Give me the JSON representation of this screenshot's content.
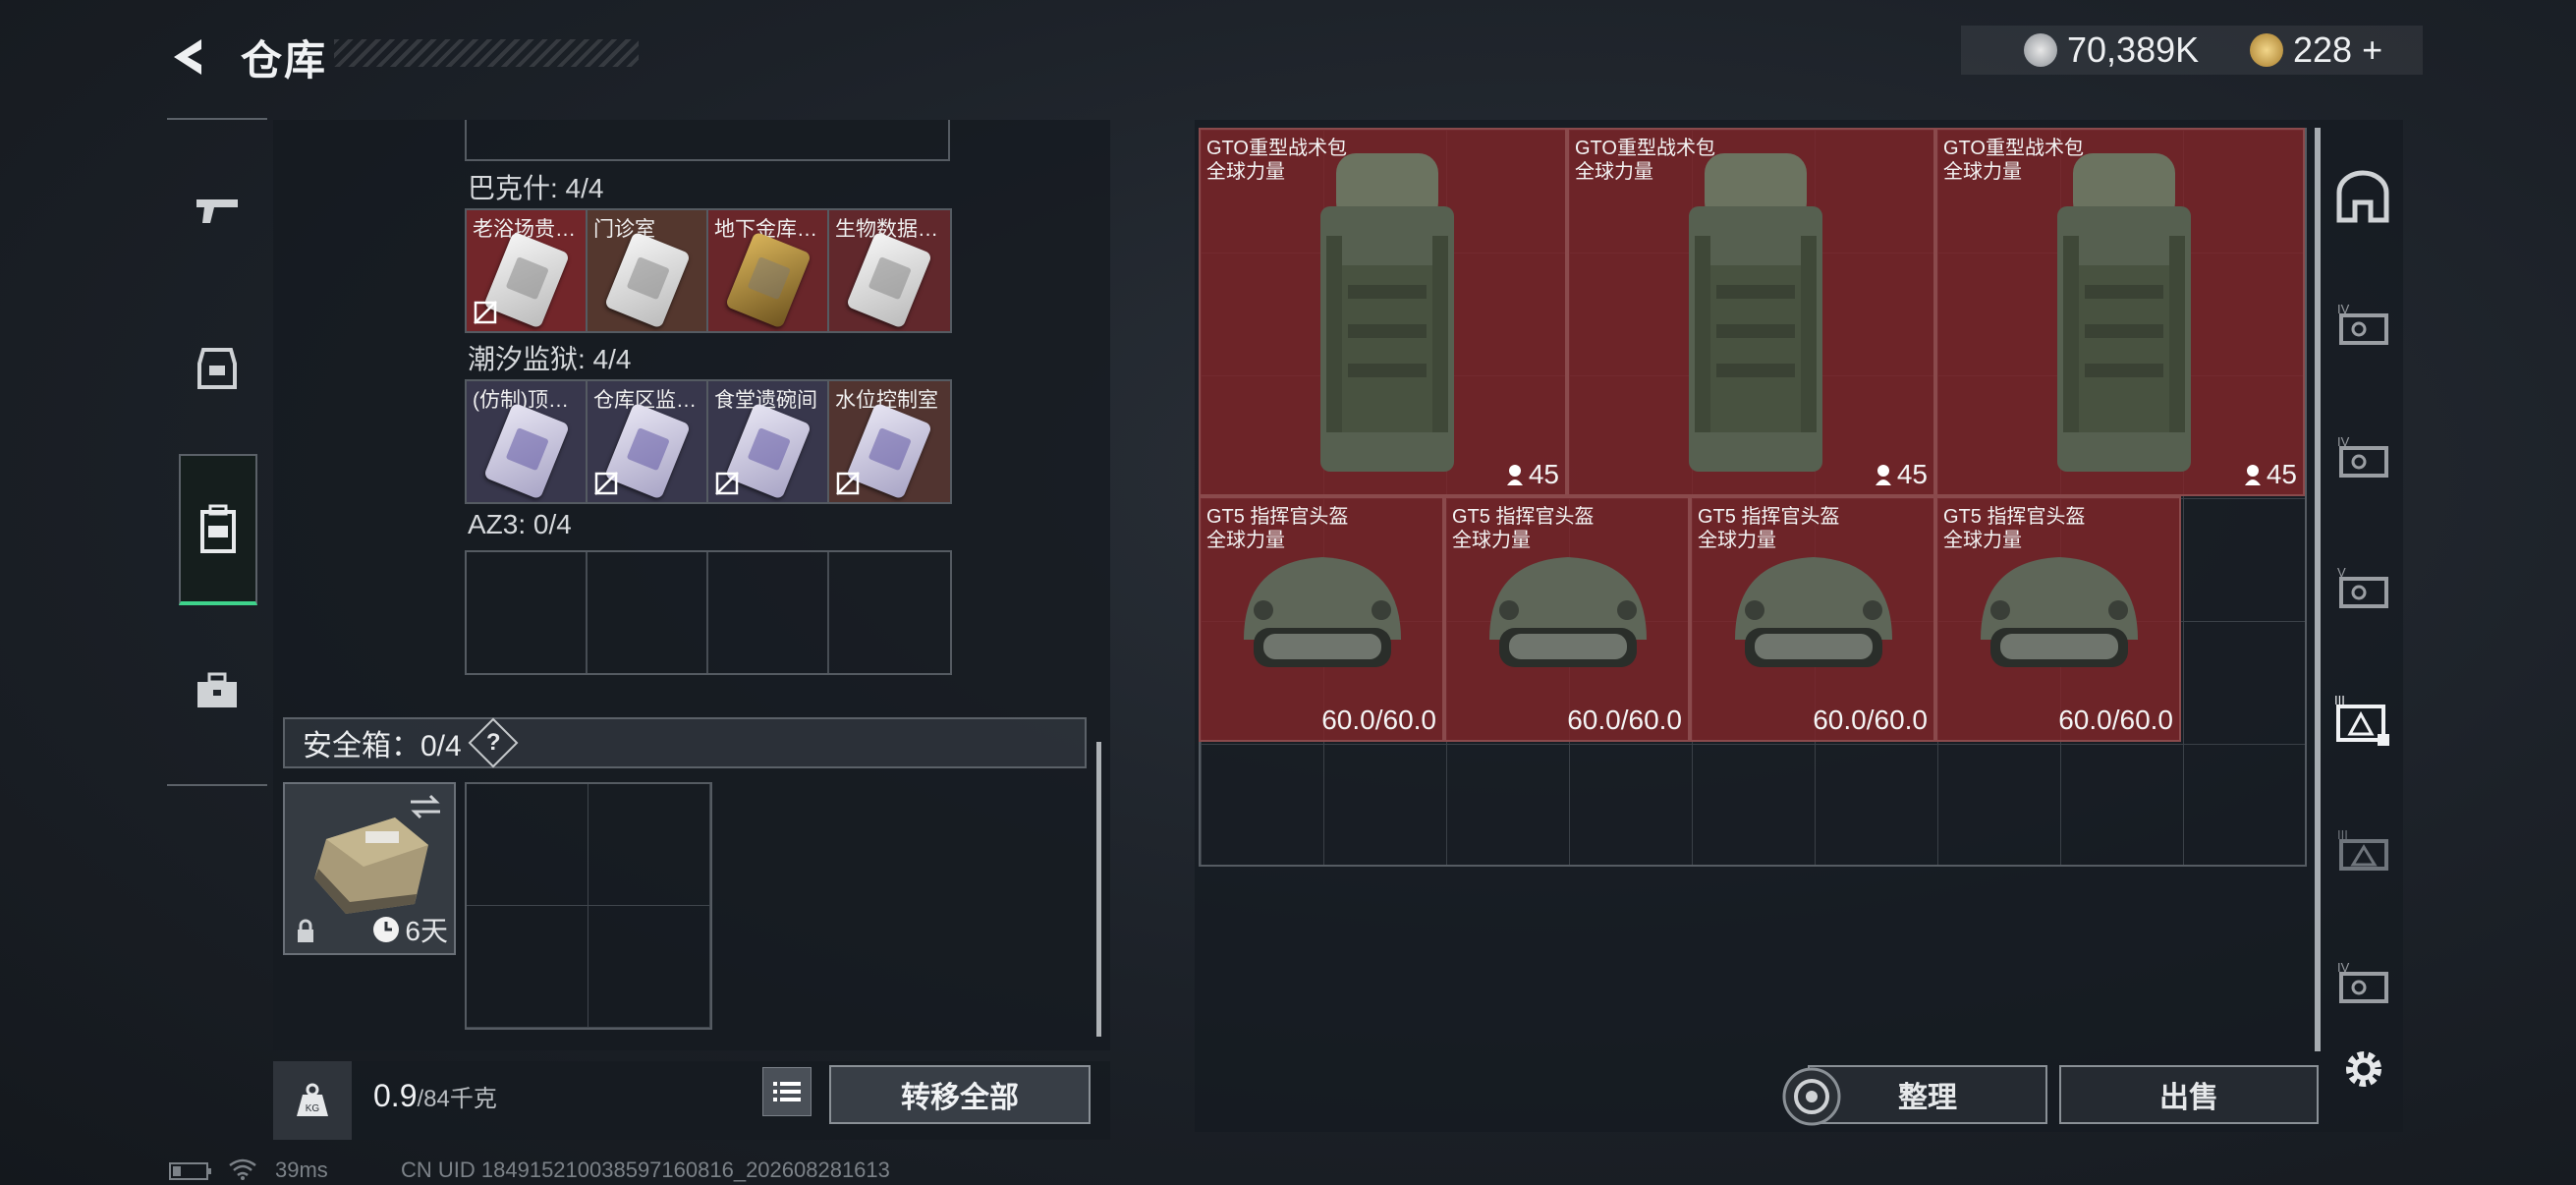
{
  "header": {
    "title": "仓库"
  },
  "currency": {
    "silver": "70,389K",
    "gold": "228",
    "add": "+"
  },
  "nav": [
    "gun-icon",
    "armor-icon",
    "backpack-icon",
    "toolbox-icon"
  ],
  "keys": {
    "sections": [
      {
        "title": "巴克什: 4/4",
        "cards": [
          {
            "label": "老浴场贵…",
            "style": "white",
            "notrade": true
          },
          {
            "label": "门诊室",
            "style": "white",
            "notrade": false
          },
          {
            "label": "地下金库…",
            "style": "gold",
            "notrade": false
          },
          {
            "label": "生物数据…",
            "style": "white",
            "notrade": false
          }
        ]
      },
      {
        "title": "潮汐监狱: 4/4",
        "cards": [
          {
            "label": "(仿制)顶…",
            "style": "purple",
            "notrade": false
          },
          {
            "label": "仓库区监…",
            "style": "purple",
            "notrade": true
          },
          {
            "label": "食堂遗碗间",
            "style": "purple",
            "notrade": true
          },
          {
            "label": "水位控制室",
            "style": "purple",
            "notrade": true
          }
        ]
      },
      {
        "title": "AZ3: 0/4"
      }
    ]
  },
  "safe": {
    "title": "安全箱：0/4",
    "help": "?",
    "days": "6天"
  },
  "bottom": {
    "weight": "0.9",
    "capacity": "/84千克",
    "transfer": "转移全部"
  },
  "stash": {
    "bags": [
      {
        "name": "GTO重型战术包",
        "sub": "全球力量",
        "count": "45"
      },
      {
        "name": "GTO重型战术包",
        "sub": "全球力量",
        "count": "45"
      },
      {
        "name": "GTO重型战术包",
        "sub": "全球力量",
        "count": "45"
      }
    ],
    "helmets": [
      {
        "name": "GT5 指挥官头盔",
        "sub": "全球力量",
        "durability": "60.0/60.0"
      },
      {
        "name": "GT5 指挥官头盔",
        "sub": "全球力量",
        "durability": "60.0/60.0"
      },
      {
        "name": "GT5 指挥官头盔",
        "sub": "全球力量",
        "durability": "60.0/60.0"
      },
      {
        "name": "GT5 指挥官头盔",
        "sub": "全球力量",
        "durability": "60.0/60.0"
      }
    ]
  },
  "sidebar_right": [
    "base-icon",
    "case-iv-icon",
    "case-iv-icon",
    "case-v-icon",
    "case-iii-icon",
    "case-iii-icon",
    "case-iv-icon"
  ],
  "actions": {
    "tidy": "整理",
    "sell": "出售"
  },
  "status": {
    "ping": "39ms",
    "uid": "CN UID 184915210038597160816_202608281613"
  }
}
